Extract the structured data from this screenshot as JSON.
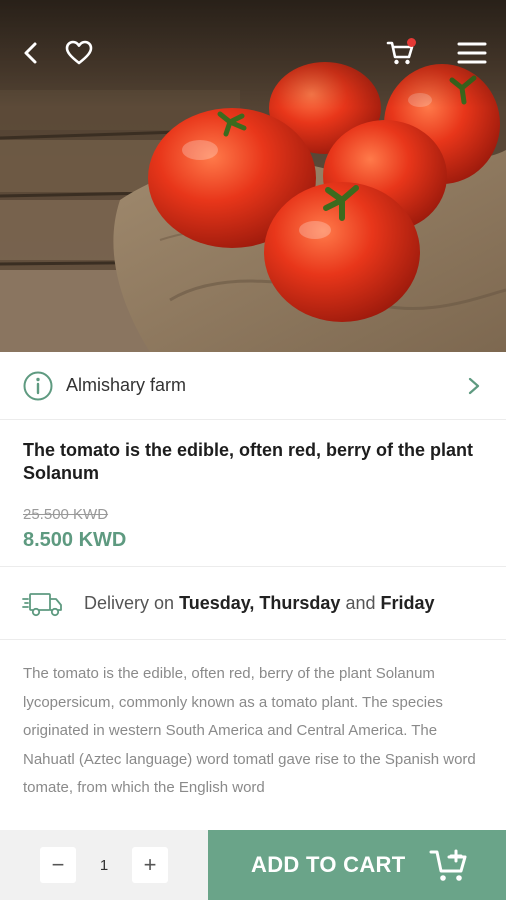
{
  "header": {
    "back_icon": "arrow-left-icon",
    "favorite_icon": "heart-outline-icon",
    "cart_icon": "cart-icon",
    "menu_icon": "hamburger-menu-icon",
    "cart_badge_color": "#e53935"
  },
  "farm": {
    "name": "Almishary farm",
    "icon": "info-circle-icon"
  },
  "product": {
    "title": "The tomato is the edible, often red, berry of the plant Solanum",
    "old_price": "25.500 KWD",
    "price": "8.500 KWD"
  },
  "delivery": {
    "prefix": "Delivery on",
    "day1": "Tuesday, Thursday",
    "joiner": "and",
    "day2": "Friday"
  },
  "description": "The tomato is the edible, often red, berry of the plant Solanum lycopersicum, commonly known as a tomato plant. The species originated in western South America and Central America. The Nahuatl (Aztec language) word tomatl gave rise to the Spanish word tomate, from which the English word",
  "cart_bar": {
    "minus": "−",
    "quantity": "1",
    "plus": "+",
    "add_label": "ADD TO CART"
  },
  "colors": {
    "accent": "#6aa489",
    "price": "#5e9a80"
  }
}
